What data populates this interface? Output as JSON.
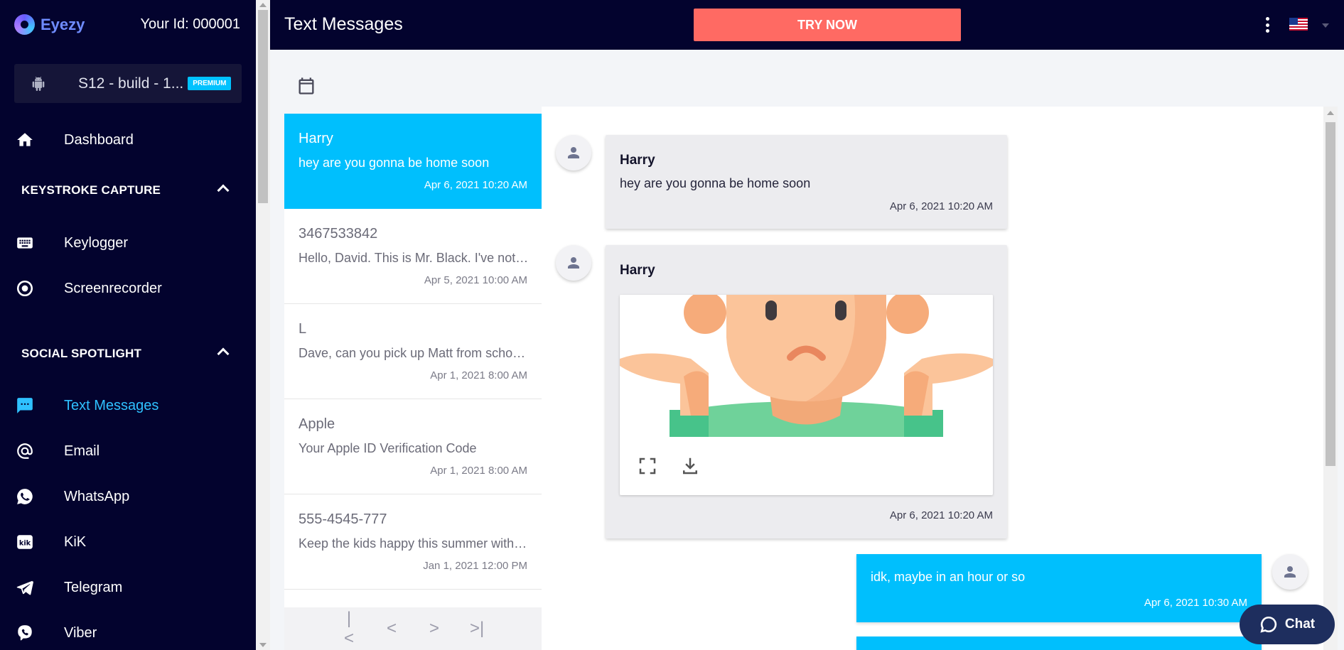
{
  "brand": {
    "name": "Eyezy",
    "user_id": "Your Id: 000001"
  },
  "device": {
    "name": "S12 - build - 1...",
    "badge": "PREMIUM"
  },
  "sidebar": {
    "dashboard": "Dashboard",
    "sections": [
      {
        "title": "KEYSTROKE CAPTURE",
        "items": [
          "Keylogger",
          "Screenrecorder"
        ]
      },
      {
        "title": "SOCIAL SPOTLIGHT",
        "items": [
          "Text Messages",
          "Email",
          "WhatsApp",
          "KiK",
          "Telegram",
          "Viber"
        ]
      }
    ],
    "active_item": "Text Messages"
  },
  "header": {
    "title": "Text Messages",
    "cta": "TRY NOW",
    "language_flag": "us-flag-icon"
  },
  "conversations": [
    {
      "name": "Harry",
      "preview": "hey are you gonna be home soon",
      "time": "Apr 6, 2021 10:20 AM",
      "active": true
    },
    {
      "name": "3467533842",
      "preview": "Hello, David. This is Mr. Black. I've noticed...",
      "time": "Apr 5, 2021 10:00 AM"
    },
    {
      "name": "L",
      "preview": "Dave, can you pick up Matt from school today?",
      "time": "Apr 1, 2021 8:00 AM"
    },
    {
      "name": "Apple",
      "preview": "Your Apple ID Verification Code",
      "time": "Apr 1, 2021 8:00 AM"
    },
    {
      "name": "555-4545-777",
      "preview": "Keep the kids happy this summer with our camp",
      "time": "Jan 1, 2021 12:00 PM"
    }
  ],
  "pager": {
    "first": "|<",
    "prev": "<",
    "next": ">",
    "last": ">|"
  },
  "thread": {
    "messages": [
      {
        "direction": "in",
        "sender": "Harry",
        "text": "hey are you gonna be home soon",
        "time": "Apr 6, 2021 10:20 AM"
      },
      {
        "direction": "in",
        "sender": "Harry",
        "attachment": "image",
        "time": "Apr 6, 2021 10:20 AM"
      },
      {
        "direction": "out",
        "text": "idk, maybe in an hour or so",
        "time": "Apr 6, 2021 10:30 AM"
      }
    ]
  },
  "chat_widget": {
    "label": "Chat"
  },
  "colors": {
    "sidebar_bg": "#03032e",
    "accent": "#00bffd",
    "cta": "#ff6a63",
    "active_nav": "#2fc1ff"
  }
}
